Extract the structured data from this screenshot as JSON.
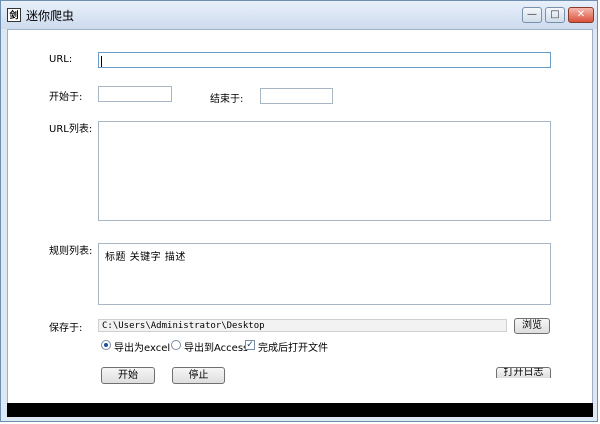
{
  "window": {
    "title": "迷你爬虫",
    "icon_name": "spider-app-icon",
    "controls": {
      "minimize": "—",
      "maximize": "□",
      "close": "✕"
    }
  },
  "form": {
    "url_label": "URL:",
    "url_value": "",
    "start_label": "开始于:",
    "start_value": "",
    "end_label": "结束于:",
    "end_value": "",
    "url_list_label": "URL列表:",
    "rules_label": "规则列表:",
    "rules_text": "标题  关键字  描述",
    "save_label": "保存于:",
    "save_path": "C:\\Users\\Administrator\\Desktop",
    "browse_button": "浏览",
    "export_options": [
      {
        "label": "导出为excel",
        "selected": true
      },
      {
        "label": "导出到Access",
        "selected": false
      }
    ],
    "open_after_label": "完成后打开文件",
    "open_after_checked": true,
    "start_button": "开始",
    "stop_button": "停止",
    "open_log_button": "打开日志"
  }
}
